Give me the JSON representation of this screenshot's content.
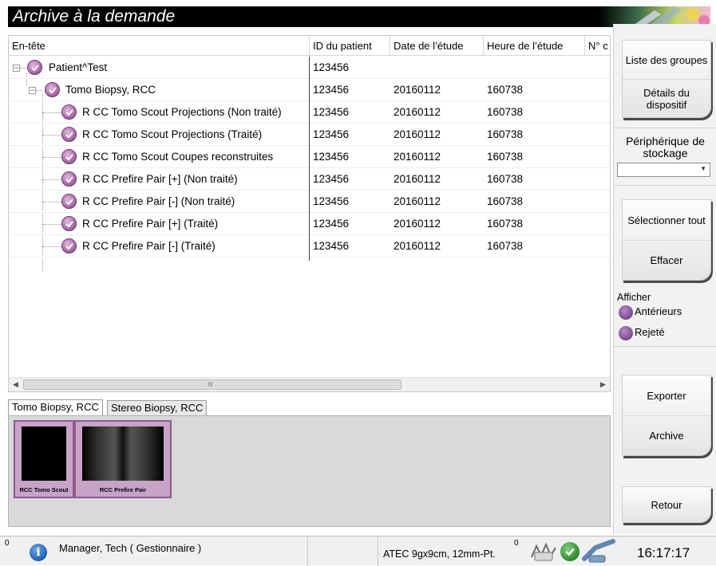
{
  "window": {
    "title": "Archive à la demande"
  },
  "table": {
    "headers": [
      "En-tête",
      "ID du patient",
      "Date de l’étude",
      "Heure de l’étude",
      "N° c"
    ],
    "rows": [
      {
        "label": "Patient^Test",
        "patient_id": "123456",
        "date": "",
        "time": ""
      },
      {
        "label": "Tomo Biopsy, RCC",
        "patient_id": "123456",
        "date": "20160112",
        "time": "160738"
      },
      {
        "label": "R CC Tomo Scout  Projections (Non traité)",
        "patient_id": "123456",
        "date": "20160112",
        "time": "160738"
      },
      {
        "label": "R CC Tomo Scout  Projections (Traité)",
        "patient_id": "123456",
        "date": "20160112",
        "time": "160738"
      },
      {
        "label": "R CC Tomo Scout  Coupes reconstruites",
        "patient_id": "123456",
        "date": "20160112",
        "time": "160738"
      },
      {
        "label": "R CC Prefire Pair [+]  (Non traité)",
        "patient_id": "123456",
        "date": "20160112",
        "time": "160738"
      },
      {
        "label": "R CC Prefire Pair [-]  (Non traité)",
        "patient_id": "123456",
        "date": "20160112",
        "time": "160738"
      },
      {
        "label": "R CC Prefire Pair [+]  (Traité)",
        "patient_id": "123456",
        "date": "20160112",
        "time": "160738"
      },
      {
        "label": "R CC Prefire Pair [-]  (Traité)",
        "patient_id": "123456",
        "date": "20160112",
        "time": "160738"
      }
    ],
    "scroll_grip": "III"
  },
  "tabs": [
    "Tomo Biopsy, RCC",
    "Stereo Biopsy, RCC"
  ],
  "thumbnails": [
    {
      "caption": "RCC Tomo Scout"
    },
    {
      "caption": "RCC Prefire Pair"
    }
  ],
  "sidebar": {
    "group_list": "Liste des groupes",
    "device_details": "Détails du dispositif",
    "storage_label": "Périphérique de stockage",
    "storage_value": "",
    "select_all": "Sélectionner tout",
    "clear": "Effacer",
    "show_label": "Afficher",
    "show_prior": "Antérieurs",
    "show_rejected": "Rejeté",
    "export": "Exporter",
    "archive": "Archive",
    "back": "Retour"
  },
  "status": {
    "count_left": "0",
    "user": "Manager, Tech ( Gestionnaire )",
    "paddle": "ATEC 9gx9cm, 12mm-Pt.",
    "count_right": "0",
    "time": "16:17:17"
  },
  "colors": {
    "accent": "#a060a0",
    "title_bg": "#000000"
  }
}
